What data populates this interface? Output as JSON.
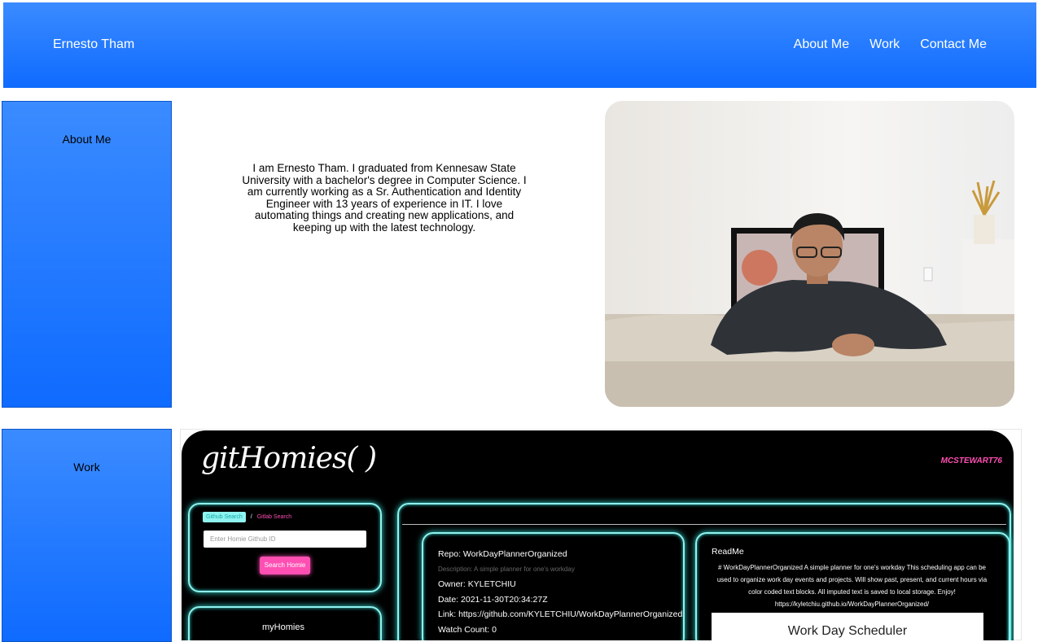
{
  "header": {
    "brand": "Ernesto Tham",
    "nav": [
      "About Me",
      "Work",
      "Contact Me"
    ]
  },
  "sections": {
    "about_label": "About Me",
    "work_label": "Work"
  },
  "about": {
    "text": "I am Ernesto Tham. I graduated from Kennesaw State University with a bachelor's degree in Computer Science. I am currently working as a Sr. Authentication and Identity Engineer with 13 years of experience in IT. I love automating things and creating new applications, and keeping up with the latest technology."
  },
  "work": {
    "app_title": "gitHomies( )",
    "username": "MCSTEWART76",
    "tab_github": "Github Search",
    "tab_sep": "/",
    "tab_gitlab": "Gitlab Search",
    "input_placeholder": "Enter Homie Github ID",
    "search_button": "Search Homie",
    "myhomies": "myHomies",
    "repo": {
      "name": "Repo: WorkDayPlannerOrganized",
      "description": "Description: A simple planner for one's workday",
      "owner": "Owner: KYLETCHIU",
      "date": "Date: 2021-11-30T20:34:27Z",
      "link": "Link: https://github.com/KYLETCHIU/WorkDayPlannerOrganized",
      "watch": "Watch Count: 0"
    },
    "readme_title": "ReadMe",
    "readme_body": "# WorkDayPlannerOrganized A simple planner for one's workday This scheduling app can be used to organize work day events and projects. Will show past, present, and current hours via color coded text blocks. All imputed text is saved to local storage. Enjoy! https://kyletchiu.github.io/WorkDayPlannerOrganized/",
    "readme_card": "Work Day Scheduler"
  },
  "colors": {
    "header_top": "#3b8bff",
    "header_bottom": "#0f6bff",
    "neon": "#8ff3ef",
    "pink": "#ff4fb3"
  }
}
